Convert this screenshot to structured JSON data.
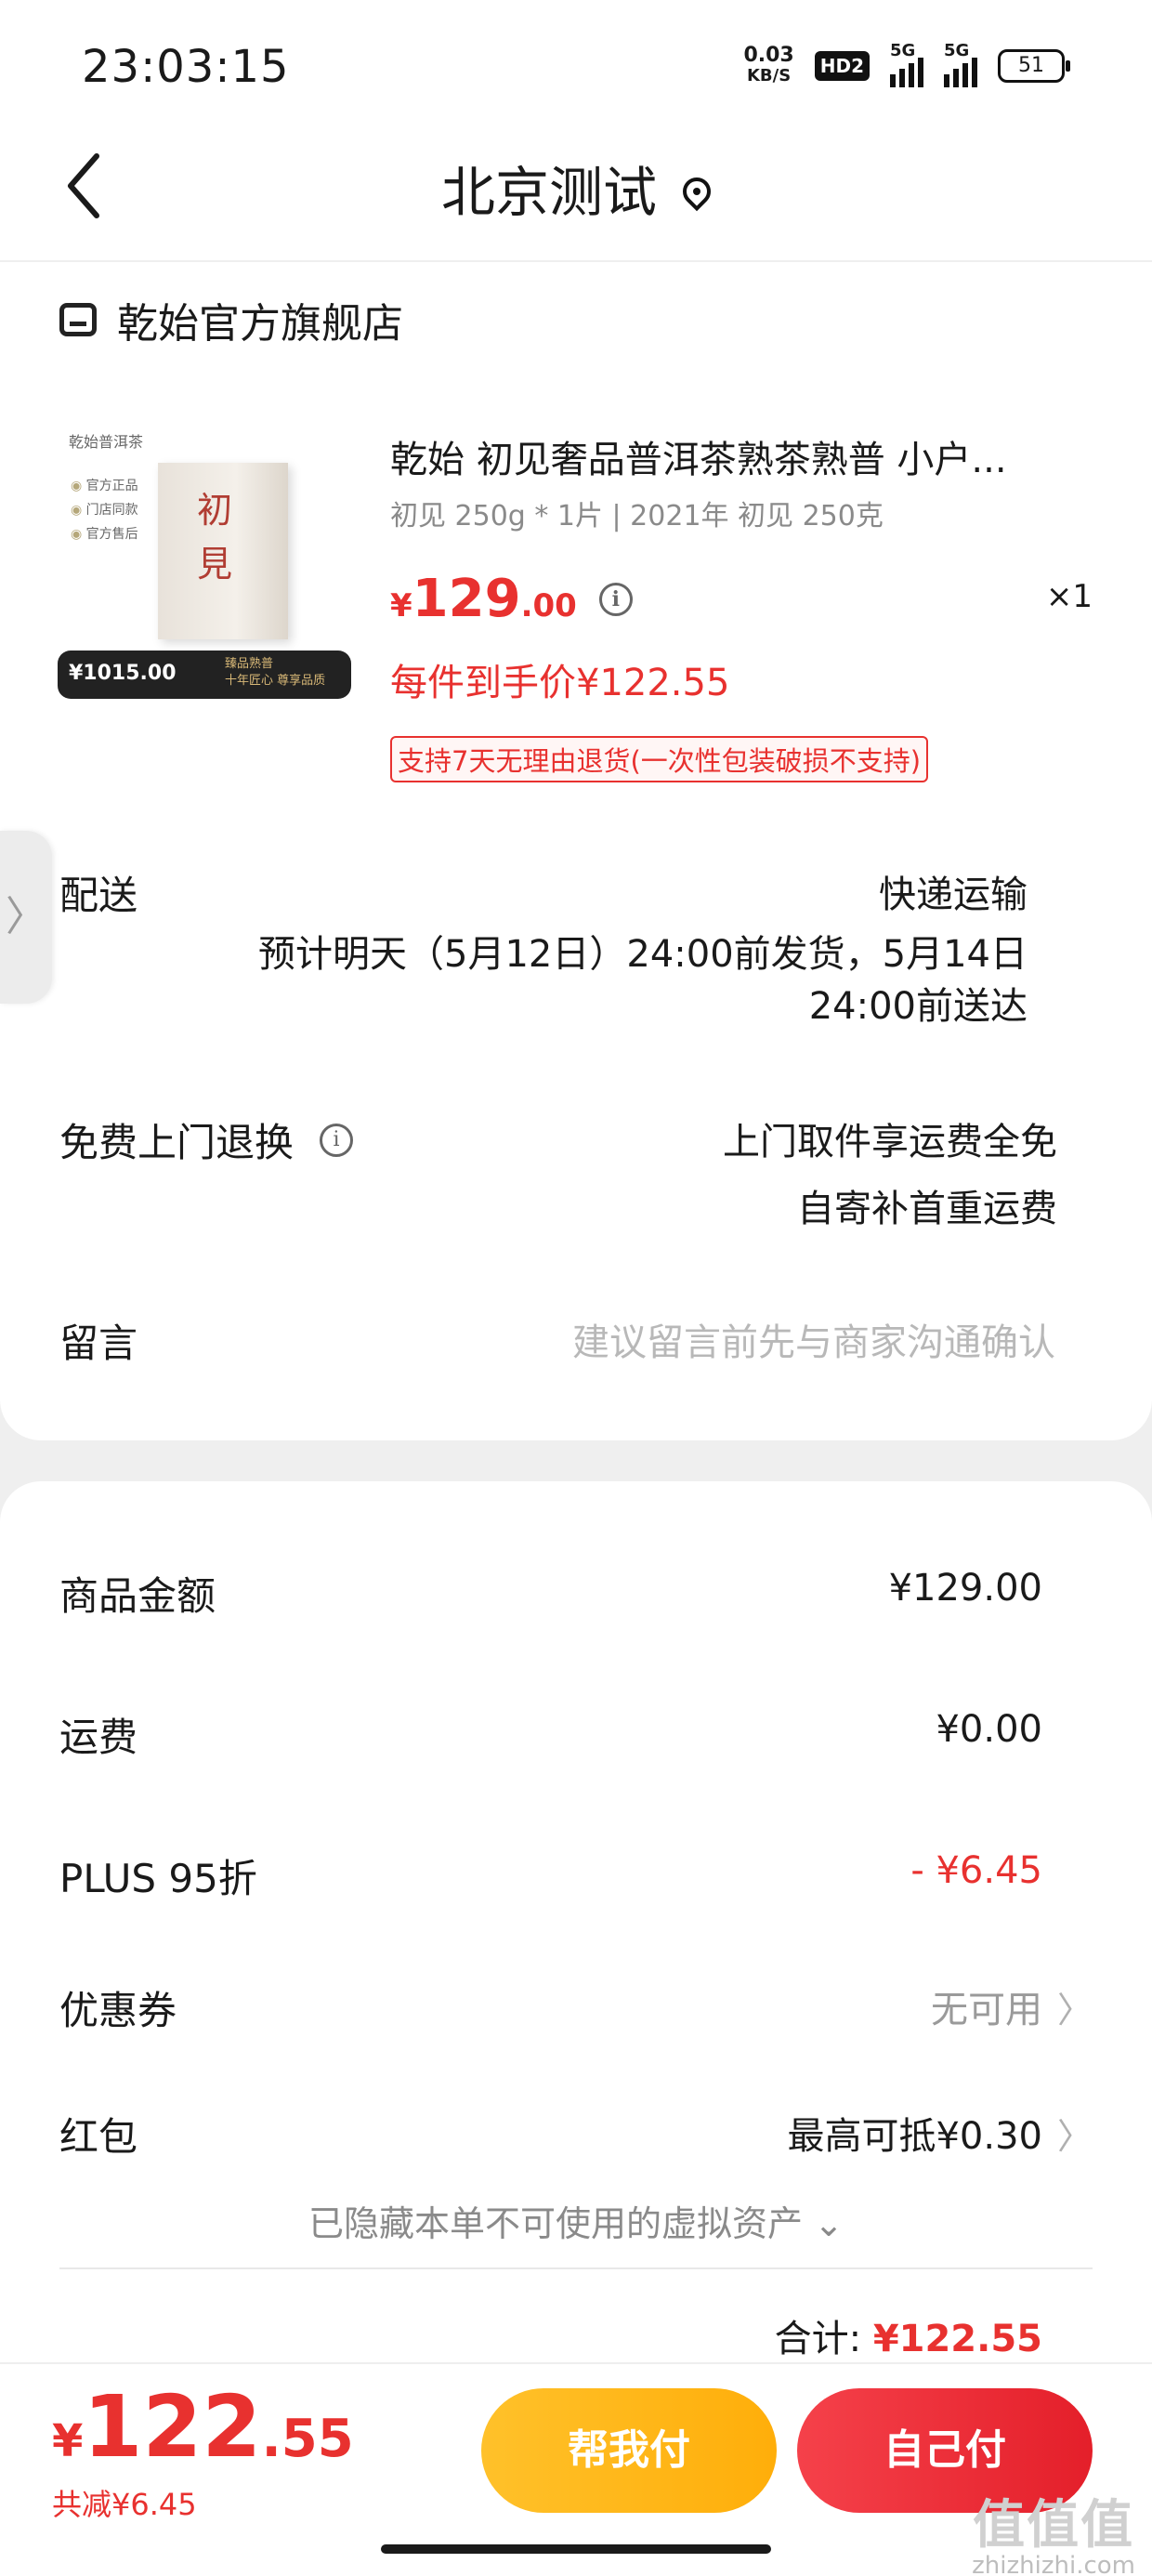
{
  "status": {
    "time": "23:03:15",
    "net_speed": "0.03",
    "net_unit": "KB/S",
    "hd": "HD2",
    "sig1": "5G",
    "sig2": "5G",
    "battery": "51"
  },
  "header": {
    "title": "北京测试"
  },
  "shop": {
    "name": "乾始官方旗舰店"
  },
  "product": {
    "title": "乾始 初见奢品普洱茶熟茶熟普 小户...",
    "spec": "初见 250g * 1片 | 2021年 初见 250克",
    "price_symbol": "¥",
    "price_int": "129",
    "price_dec": ".00",
    "quantity": "×1",
    "unit_price": "每件到手价¥122.55",
    "return_policy": "支持7天无理由退货(一次性包装破损不支持)",
    "image": {
      "brand": "乾始普洱茶",
      "tags": [
        "官方正品",
        "门店同款",
        "官方售后"
      ],
      "char1": "初",
      "char2": "見",
      "band_price": "¥1015.00",
      "band_gift_1": "臻品熟普",
      "band_gift_2": "十年匠心 尊享品质"
    }
  },
  "side_tab": {
    "glyph": "〉"
  },
  "delivery": {
    "label": "配送",
    "method": "快递运输",
    "eta_line1": "预计明天（5月12日）24:00前发货，5月14日",
    "eta_line2": "24:00前送达"
  },
  "free_return": {
    "label": "免费上门退换",
    "info_glyph": "i",
    "line1": "上门取件享运费全免",
    "line2": "自寄补首重运费"
  },
  "message": {
    "label": "留言",
    "placeholder": "建议留言前先与商家沟通确认"
  },
  "fees": {
    "goods_label": "商品金额",
    "goods_value": "¥129.00",
    "shipping_label": "运费",
    "shipping_value": "¥0.00",
    "plus_label": "PLUS 95折",
    "plus_value": "- ¥6.45",
    "coupon_label": "优惠券",
    "coupon_value": "无可用",
    "redpacket_label": "红包",
    "redpacket_value": "最高可抵¥0.30",
    "chevron": "〉"
  },
  "hidden_assets": {
    "text": "已隐藏本单不可使用的虚拟资产",
    "arrow": "⌄"
  },
  "total": {
    "label": "合计: ",
    "value": "¥122.55"
  },
  "bottom": {
    "symbol": "¥",
    "int": "122",
    "dec": ".55",
    "saved": "共减¥6.45",
    "help_pay": "帮我付",
    "self_pay": "自己付"
  },
  "watermark": {
    "logo": "值值值",
    "site": "zhizhizhi.com"
  },
  "colors": {
    "accent_red": "#e8312f",
    "button_yellow": "#ffb519",
    "button_red": "#ec2d36",
    "page_bg": "#efefef"
  }
}
